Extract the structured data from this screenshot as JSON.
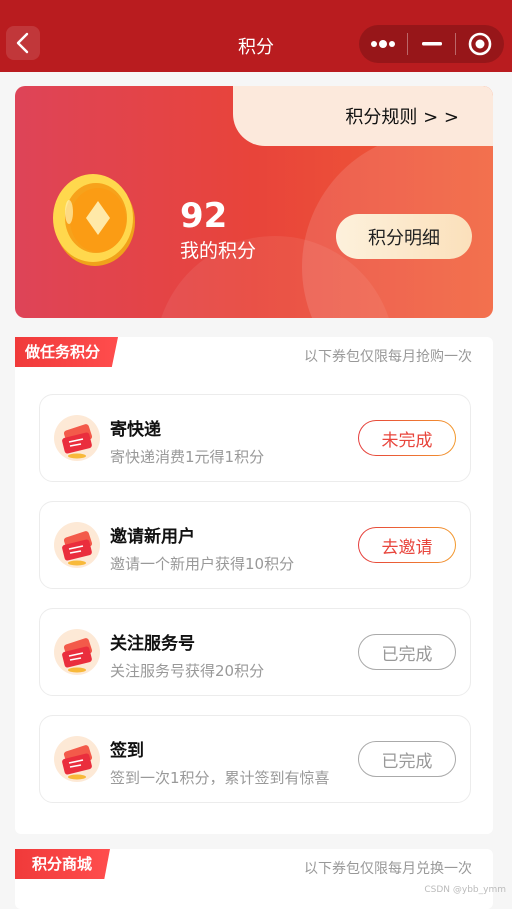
{
  "nav": {
    "title": "积分"
  },
  "hero": {
    "rules_link": "积分规则 > >",
    "points_value": "92",
    "points_label": "我的积分",
    "detail_button": "积分明细"
  },
  "tasks_section": {
    "tag": "做任务积分",
    "note": "以下券包仅限每月抢购一次",
    "items": [
      {
        "title": "寄快递",
        "desc": "寄快递消费1元得1积分",
        "button": "未完成",
        "state": "active"
      },
      {
        "title": "邀请新用户",
        "desc": "邀请一个新用户获得10积分",
        "button": "去邀请",
        "state": "active"
      },
      {
        "title": "关注服务号",
        "desc": "关注服务号获得20积分",
        "button": "已完成",
        "state": "done"
      },
      {
        "title": "签到",
        "desc": "签到一次1积分，累计签到有惊喜",
        "button": "已完成",
        "state": "done"
      }
    ]
  },
  "mall_section": {
    "tag": "积分商城",
    "note": "以下券包仅限每月兑换一次"
  },
  "watermark": "CSDN @ybb_ymm",
  "colors": {
    "navbar": "#b91c1f",
    "accent": "#e8453c",
    "tag": "#f03a3a"
  }
}
